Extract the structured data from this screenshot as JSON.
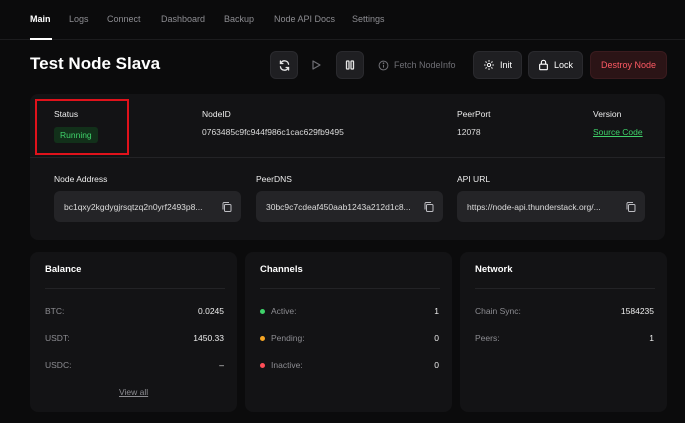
{
  "nav": {
    "items": [
      {
        "label": "Main",
        "active": true
      },
      {
        "label": "Logs"
      },
      {
        "label": "Connect"
      },
      {
        "label": "Dashboard"
      },
      {
        "label": "Backup"
      },
      {
        "label": "Node API Docs"
      },
      {
        "label": "Settings"
      }
    ]
  },
  "header": {
    "title": "Test Node Slava",
    "buttons": {
      "refresh_icon": "refresh-icon",
      "play_icon": "play-icon",
      "pause_icon": "pause-icon",
      "fetch_label": "Fetch NodeInfo",
      "init_label": "Init",
      "lock_label": "Lock",
      "destroy_label": "Destroy Node"
    }
  },
  "info": {
    "status_label": "Status",
    "status_value": "Running",
    "nodeid_label": "NodeID",
    "nodeid_value": "0763485c9fc944f986c1cac629fb9495",
    "peerport_label": "PeerPort",
    "peerport_value": "12078",
    "version_label": "Version",
    "version_value": "Source Code",
    "address_label": "Node Address",
    "address_value": "bc1qxy2kgdygjrsqtzq2n0yrf2493p8...",
    "peerdns_label": "PeerDNS",
    "peerdns_value": "30bc9c7cdeaf450aab1243a212d1c8...",
    "apiurl_label": "API URL",
    "apiurl_value": "https://node-api.thunderstack.org/..."
  },
  "balance": {
    "title": "Balance",
    "rows": [
      {
        "label": "BTC:",
        "value": "0.0245"
      },
      {
        "label": "USDT:",
        "value": "1450.33"
      },
      {
        "label": "USDC:",
        "value": "–"
      }
    ],
    "view_all": "View all"
  },
  "channels": {
    "title": "Channels",
    "rows": [
      {
        "label": "Active:",
        "value": "1"
      },
      {
        "label": "Pending:",
        "value": "0"
      },
      {
        "label": "Inactive:",
        "value": "0"
      }
    ]
  },
  "network": {
    "title": "Network",
    "rows": [
      {
        "label": "Chain Sync:",
        "value": "1584235"
      },
      {
        "label": "Peers:",
        "value": "1"
      }
    ]
  },
  "colors": {
    "background": "#0b0b0c",
    "card": "#131315",
    "accent_green": "#3fd26a",
    "danger_red": "#ff5a64",
    "pending_orange": "#f5a524",
    "highlight_red": "#e0121b"
  }
}
